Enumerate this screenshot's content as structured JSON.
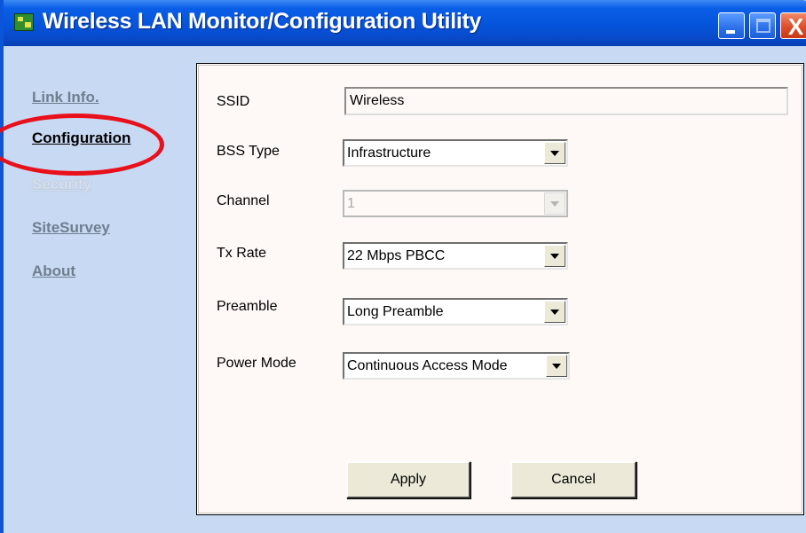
{
  "window": {
    "title": "Wireless LAN Monitor/Configuration Utility",
    "controls": {
      "minimize_icon": "minimize-icon",
      "maximize_icon": "maximize-icon",
      "close_glyph": "X"
    }
  },
  "sidebar": {
    "items": [
      {
        "label": "Link Info.",
        "state": "normal"
      },
      {
        "label": "Configuration",
        "state": "active"
      },
      {
        "label": "Security",
        "state": "faded"
      },
      {
        "label": "SiteSurvey",
        "state": "normal"
      },
      {
        "label": "About",
        "state": "normal"
      }
    ]
  },
  "form": {
    "ssid": {
      "label": "SSID",
      "value": "Wireless"
    },
    "bss_type": {
      "label": "BSS Type",
      "value": "Infrastructure"
    },
    "channel": {
      "label": "Channel",
      "value": "1",
      "disabled": true
    },
    "tx_rate": {
      "label": "Tx Rate",
      "value": "22 Mbps PBCC"
    },
    "preamble": {
      "label": "Preamble",
      "value": "Long Preamble"
    },
    "power_mode": {
      "label": "Power Mode",
      "value": "Continuous Access Mode"
    }
  },
  "buttons": {
    "apply": "Apply",
    "cancel": "Cancel"
  },
  "colors": {
    "title_bar": "#0654dc",
    "window_background": "#c7d9f3",
    "highlight_ring": "#e8101a",
    "panel_background": "#fef9f6"
  }
}
